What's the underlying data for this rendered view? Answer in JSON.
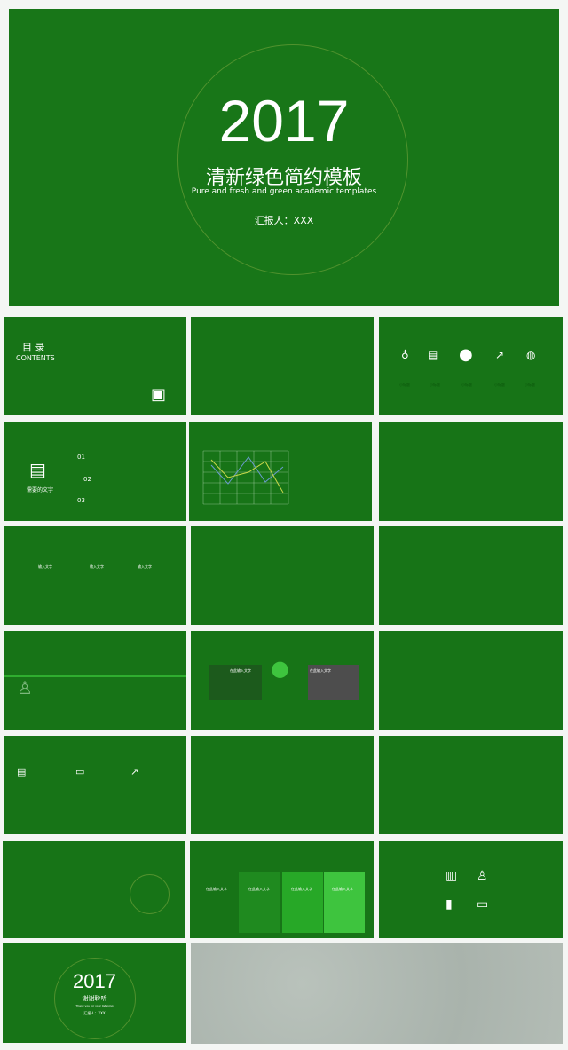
{
  "cover": {
    "year": "2017",
    "title": "清新绿色简约模板",
    "subtitle": "Pure and fresh and green academic templates",
    "reporter": "汇报人：XXX"
  },
  "toc": {
    "title": "目 录",
    "subtitle": "CONTENTS"
  },
  "icons_slide": {
    "labels": [
      "小标题",
      "小标题",
      "小标题",
      "小标题",
      "小标题"
    ]
  },
  "text_slide": {
    "caption": "需要的文字",
    "numbers": [
      "01",
      "02",
      "03"
    ]
  },
  "boxes_slide": {
    "headers": [
      "输入文字",
      "输入文字",
      "输入文字"
    ]
  },
  "bulb_slide": {
    "left": "在此输入文字",
    "right": "在此输入文字"
  },
  "table_slide": {
    "headers": [
      "在此输入文字",
      "在此输入文字",
      "在此输入文字",
      "在此输入文字"
    ]
  },
  "end": {
    "year": "2017",
    "title": "谢谢聆听",
    "subtitle": "Thank you for your listening",
    "reporter": "汇报人：XXX"
  },
  "colors": {
    "green": "#177417",
    "light_green": "#3ec43e",
    "texture": "#b3bcb5"
  }
}
